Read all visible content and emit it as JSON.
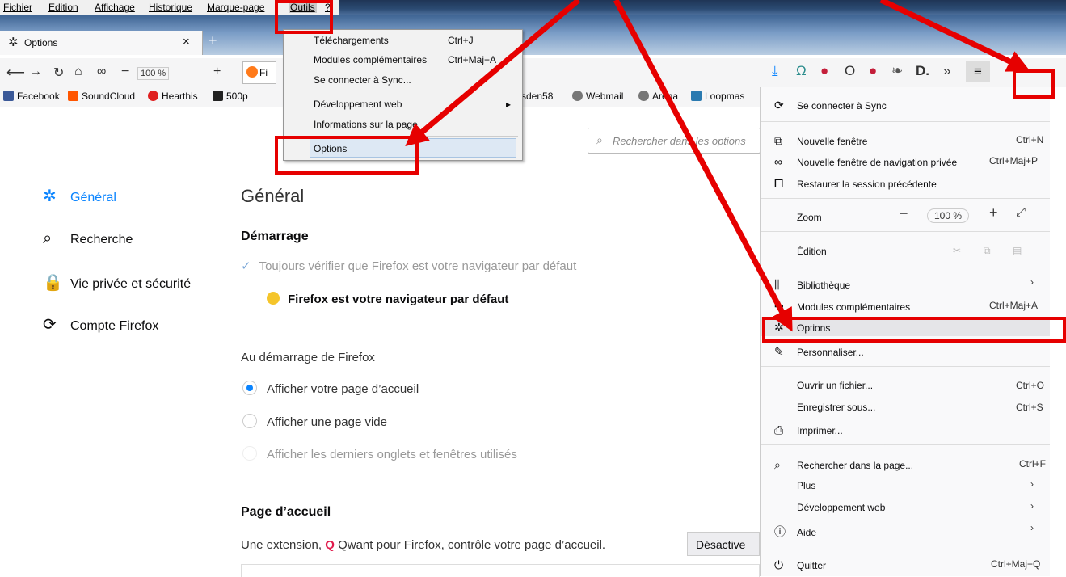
{
  "menubar": [
    "Fichier",
    "Edition",
    "Affichage",
    "Historique",
    "Marque-page",
    "Outils",
    "?"
  ],
  "tab": {
    "title": "Options",
    "close": "×",
    "new": "+"
  },
  "nav": {
    "zoom": "100 %",
    "url_fragment": "Fi"
  },
  "bookmarks": [
    "Facebook",
    "SoundCloud",
    "Hearthis",
    "500p",
    "sden58",
    "Webmail",
    "Arena",
    "Loopmas"
  ],
  "outils_menu": [
    {
      "label": "Téléchargements",
      "shortcut": "Ctrl+J"
    },
    {
      "label": "Modules complémentaires",
      "shortcut": "Ctrl+Maj+A"
    },
    {
      "label": "Se connecter à Sync...",
      "shortcut": ""
    },
    {
      "label": "Développement web",
      "shortcut": "▸"
    },
    {
      "label": "Informations sur la page",
      "shortcut": ""
    },
    {
      "label": "Options",
      "shortcut": ""
    }
  ],
  "search_placeholder": "Rechercher dans les options",
  "sidebar": [
    {
      "label": "Général",
      "icon": "gear-icon",
      "active": true
    },
    {
      "label": "Recherche",
      "icon": "search-icon"
    },
    {
      "label": "Vie privée et sécurité",
      "icon": "lock-icon"
    },
    {
      "label": "Compte Firefox",
      "icon": "sync-icon"
    }
  ],
  "content": {
    "title": "Général",
    "startup_heading": "Démarrage",
    "default_check": "Toujours vérifier que Firefox est votre navigateur par défaut",
    "default_status": "Firefox est votre navigateur par défaut",
    "at_start_label": "Au démarrage de Firefox",
    "radio1": "Afficher votre page d’accueil",
    "radio2": "Afficher une page vide",
    "radio3": "Afficher les derniers onglets et fenêtres utilisés",
    "home_heading": "Page d’accueil",
    "ext_text_pre": "Une extension,",
    "ext_text_post": "Qwant pour Firefox, contrôle votre page d’accueil.",
    "disable_btn": "Désactive"
  },
  "panel": {
    "sync": "Se connecter à Sync",
    "new_window": "Nouvelle fenêtre",
    "new_window_key": "Ctrl+N",
    "private": "Nouvelle fenêtre de navigation privée",
    "private_key": "Ctrl+Maj+P",
    "restore": "Restaurer la session précédente",
    "zoom": "Zoom",
    "zoom_value": "100 %",
    "edit": "Édition",
    "library": "Bibliothèque",
    "addons": "Modules complémentaires",
    "addons_key": "Ctrl+Maj+A",
    "options": "Options",
    "customize": "Personnaliser...",
    "open_file": "Ouvrir un fichier...",
    "open_file_key": "Ctrl+O",
    "save_as": "Enregistrer sous...",
    "save_as_key": "Ctrl+S",
    "print": "Imprimer...",
    "find": "Rechercher dans la page...",
    "find_key": "Ctrl+F",
    "more": "Plus",
    "webdev": "Développement web",
    "help": "Aide",
    "quit": "Quitter",
    "quit_key": "Ctrl+Maj+Q"
  },
  "colors": {
    "accent": "#0a84ff",
    "annotation": "#e60000"
  }
}
